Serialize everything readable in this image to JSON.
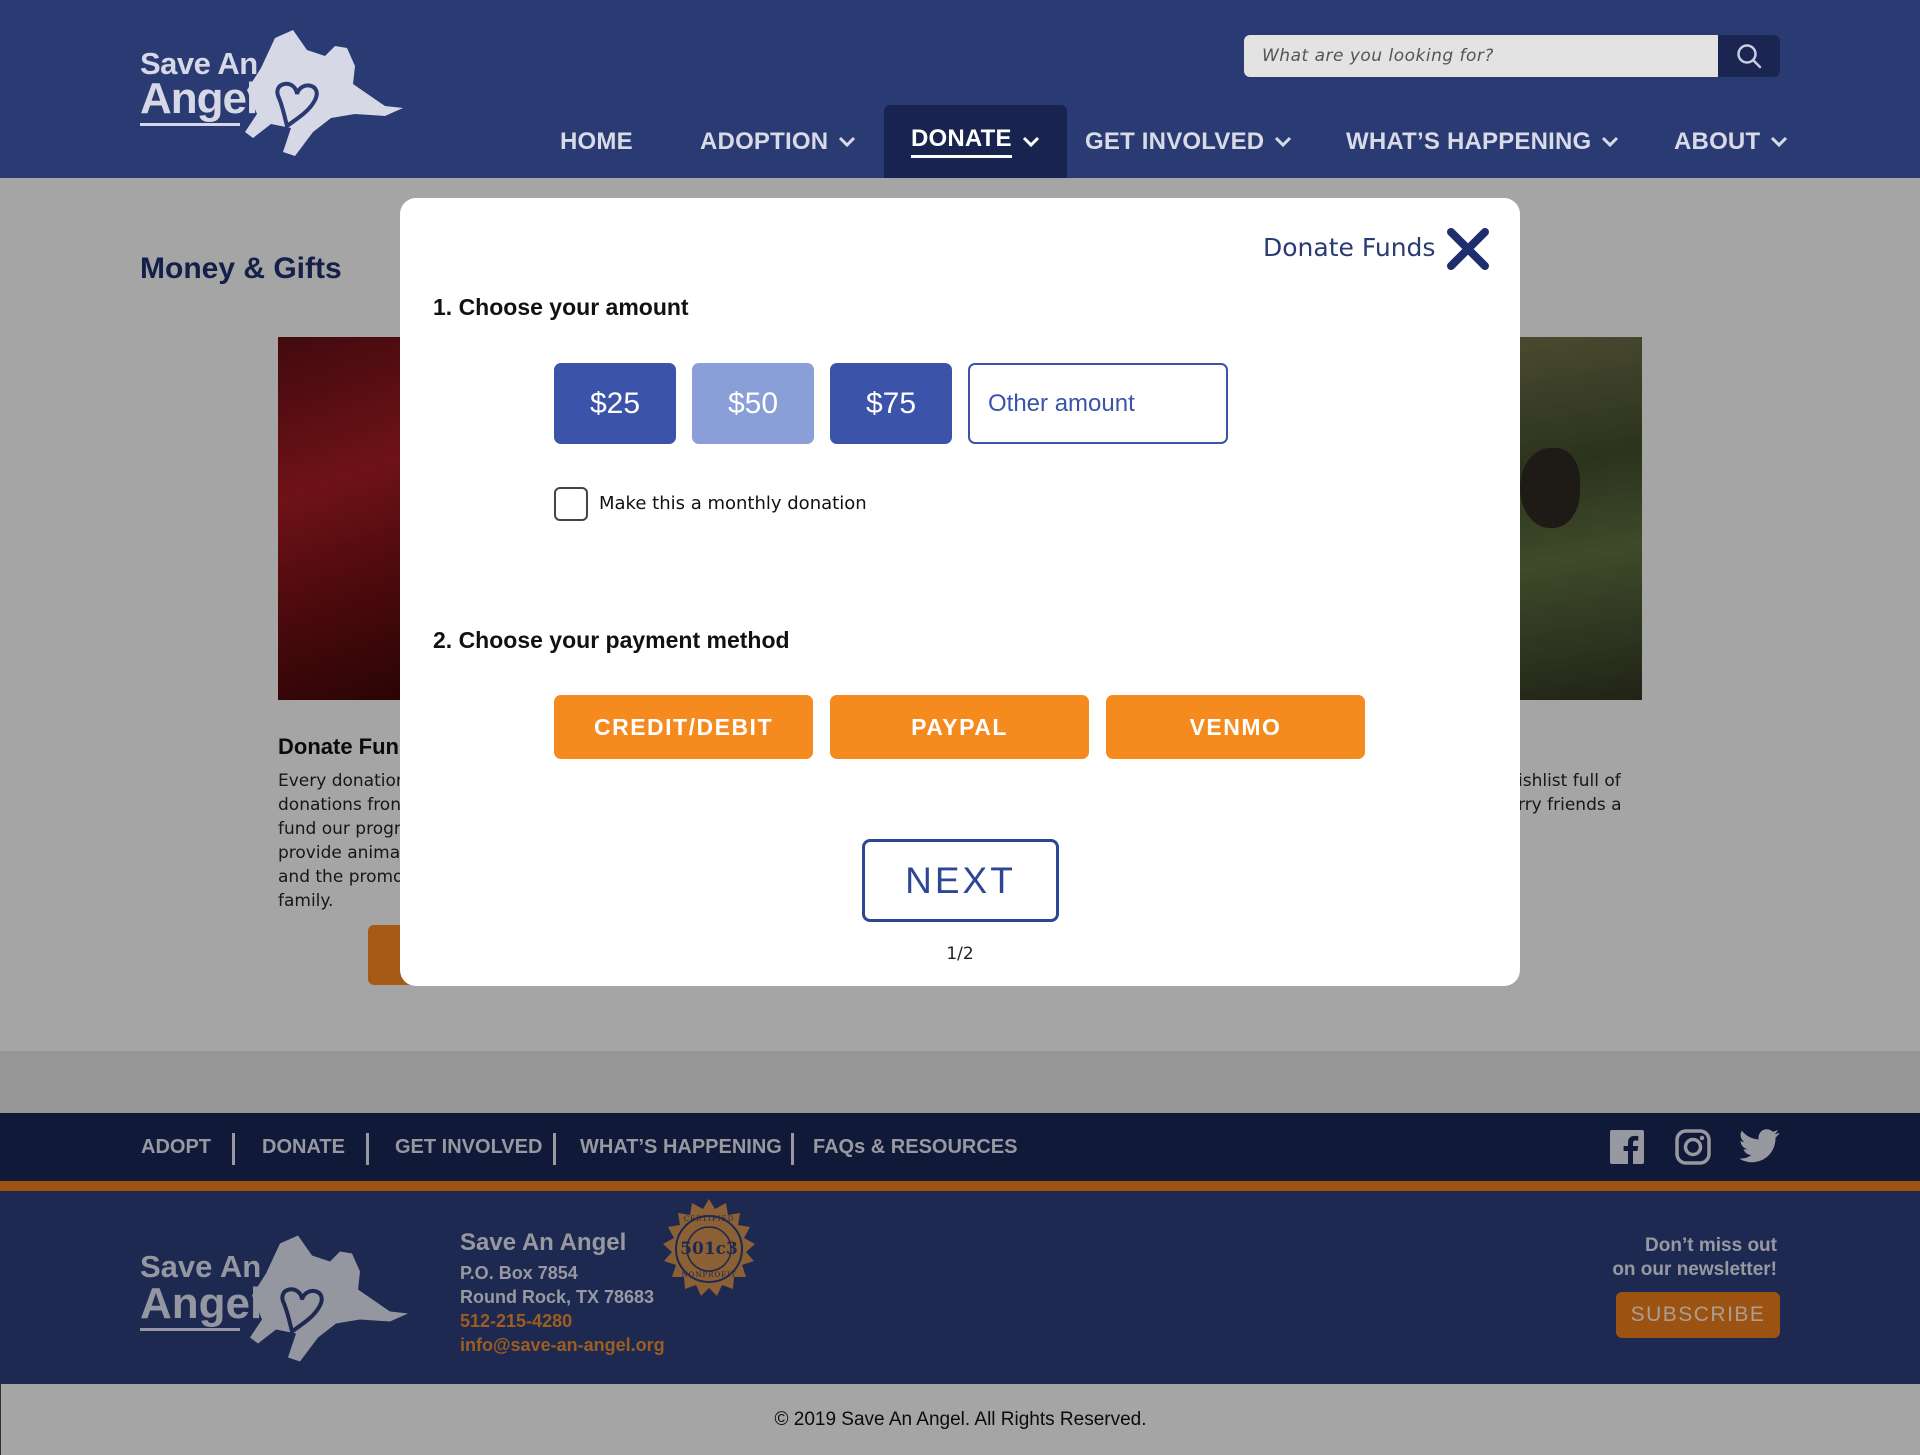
{
  "header": {
    "logo": {
      "line1": "Save An",
      "line2": "Angel"
    },
    "search": {
      "placeholder": "What are you looking for?",
      "icon": "search-icon"
    },
    "nav": [
      {
        "label": "HOME",
        "dropdown": false
      },
      {
        "label": "ADOPTION",
        "dropdown": true
      },
      {
        "label": "DONATE",
        "dropdown": true,
        "active": true
      },
      {
        "label": "GET INVOLVED",
        "dropdown": true
      },
      {
        "label": "WHAT’S HAPPENING",
        "dropdown": true
      },
      {
        "label": "ABOUT",
        "dropdown": true
      }
    ]
  },
  "page": {
    "title": "Money & Gifts",
    "cards": [
      {
        "title": "Donate Fun",
        "text_lines": [
          "Every donation",
          "donations fron",
          "fund our progr",
          "provide animal",
          "and the promo",
          "family."
        ]
      },
      {
        "text_lines": [
          "ishlist full of",
          "rry friends a"
        ]
      }
    ]
  },
  "modal": {
    "title": "Donate Funds",
    "close_icon": "close-icon",
    "step1": "1. Choose your amount",
    "amounts": [
      "$25",
      "$50",
      "$75"
    ],
    "selected_amount": "$50",
    "other_placeholder": "Other amount",
    "monthly_label": "Make this a monthly donation",
    "monthly_checked": false,
    "step2": "2. Choose your payment method",
    "payment_methods": [
      "CREDIT/DEBIT",
      "PAYPAL",
      "VENMO"
    ],
    "next_label": "NEXT",
    "pager": "1/2"
  },
  "footer": {
    "links": [
      "ADOPT",
      "DONATE",
      "GET INVOLVED",
      "WHAT’S HAPPENING",
      "FAQs & RESOURCES"
    ],
    "social": [
      "facebook-icon",
      "instagram-icon",
      "twitter-icon"
    ],
    "org_name": "Save An Angel",
    "address1": "P.O. Box 7854",
    "address2": "Round Rock, TX 78683",
    "phone": "512-215-4280",
    "email": "info@save-an-angel.org",
    "seal": {
      "top": "CERTIFIED",
      "center": "501c3",
      "bottom": "NONPROFIT"
    },
    "newsletter_line1": "Don’t miss out",
    "newsletter_line2": "on our newsletter!",
    "subscribe_label": "SUBSCRIBE",
    "copyright": "© 2019 Save An Angel. All Rights Reserved."
  },
  "colors": {
    "brand_blue": "#2a3b73",
    "dark_blue": "#18244f",
    "accent_orange": "#f58a1f",
    "button_blue": "#3b53a8",
    "button_blue_light": "#8a9ed8"
  }
}
